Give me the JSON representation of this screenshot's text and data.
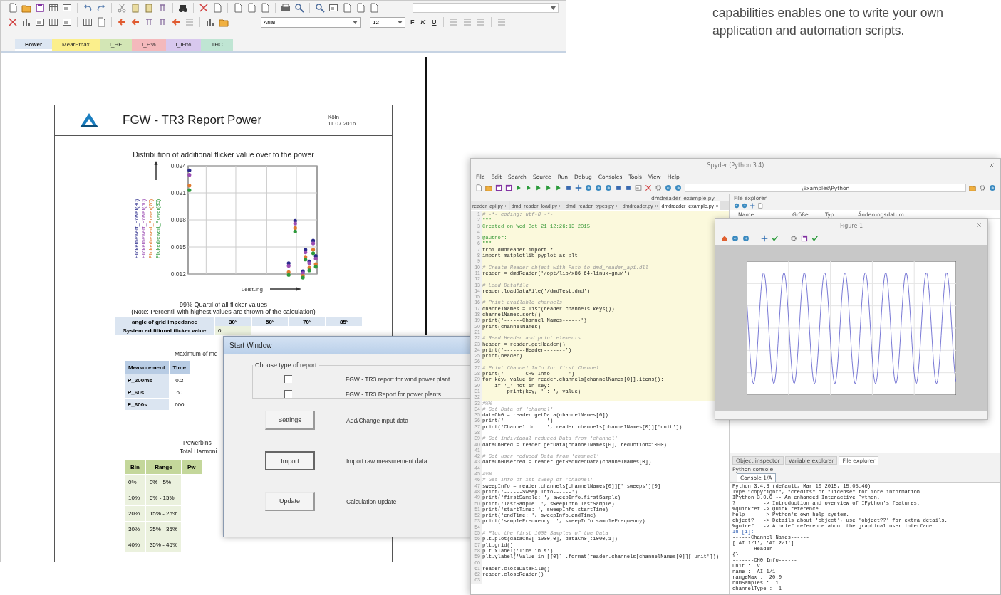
{
  "intro_text": "capabilities enables one to write your own application and automation scripts.",
  "report_window": {
    "font_name": "Arial",
    "font_size": "12",
    "format_buttons": [
      "F",
      "K",
      "U"
    ],
    "sheet_tabs": [
      {
        "label": "Power",
        "selected": true,
        "color": "#dce6f2"
      },
      {
        "label": "MearPmax",
        "selected": false,
        "color": "#fbef8c"
      },
      {
        "label": "I_HF",
        "selected": false,
        "color": "#d3e6b5"
      },
      {
        "label": "I_H%",
        "selected": false,
        "color": "#f4b9bc"
      },
      {
        "label": "I_IH%",
        "selected": false,
        "color": "#d8c8ee"
      },
      {
        "label": "THC",
        "selected": false,
        "color": "#bfe5d3"
      }
    ],
    "report": {
      "title": "FGW - TR3  Report Power",
      "place": "Köln",
      "date": "11.07.2016",
      "flicker_chart": {
        "title": "Distribution of additional flicker value over to the power",
        "xlabel": "Leistung",
        "y_tick_labels": [
          "0.024",
          "0.021",
          "0.018",
          "0.015",
          "0.012"
        ],
        "series": [
          {
            "name": "Flickerbewert_Power(30)",
            "color": "#2b2b8c"
          },
          {
            "name": "Flickerbewert_Power(50)",
            "color": "#9b4db3"
          },
          {
            "name": "Flickerbewert_Power(70)",
            "color": "#e07b30"
          },
          {
            "name": "Flickerbewert_Power(85)",
            "color": "#2f9a3c"
          }
        ]
      },
      "quantile_title": "99% Quartil of all flicker values",
      "quantile_note": "(Note: Percentil with highest values are thrown of the calculation)",
      "angle_table": {
        "columns": [
          "angle of grid impedance",
          "30°",
          "50°",
          "70°",
          "85°"
        ],
        "rows": [
          [
            "System additional flicker value",
            "0."
          ]
        ]
      },
      "maximum_title": "Maximum of me",
      "maximum_table": {
        "columns": [
          "Measurement",
          "Time"
        ],
        "rows": [
          [
            "P_200ms",
            "0.2"
          ],
          [
            "P_60s",
            "60"
          ],
          [
            "P_600s",
            "600"
          ]
        ]
      },
      "powerbins_title": "Powerbins",
      "powerbins_subtitle": "Total Harmoni",
      "powerbins_table": {
        "columns": [
          "Bin",
          "Range",
          "Pw"
        ],
        "rows": [
          [
            "0%",
            "0% - 5%"
          ],
          [
            "10%",
            "5% - 15%"
          ],
          [
            "20%",
            "15% - 25%"
          ],
          [
            "30%",
            "25% - 35%"
          ],
          [
            "40%",
            "35% - 45%"
          ]
        ]
      }
    }
  },
  "start_window": {
    "title": "Start Window",
    "group_title": "Choose type of report",
    "report_types": [
      {
        "label": "FGW - TR3 report for wind power plant",
        "checked": false
      },
      {
        "label": "FGW - TR3 Report for power plants",
        "checked": false
      }
    ],
    "actions": [
      {
        "button": "Settings",
        "description": "Add/Change input data",
        "default": false
      },
      {
        "button": "Import",
        "description": "Import raw measurement data",
        "default": true
      },
      {
        "button": "Update",
        "description": "Calculation update",
        "default": false
      }
    ]
  },
  "spyder": {
    "title": "Spyder (Python 3.4)",
    "menu": [
      "File",
      "Edit",
      "Search",
      "Source",
      "Run",
      "Debug",
      "Consoles",
      "Tools",
      "View",
      "Help"
    ],
    "path": "\\Examples\\Python",
    "current_file": "dmdreader_example.py",
    "explorer_title": "File explorer",
    "editor_tabs": [
      {
        "label": "reader_api.py",
        "selected": false
      },
      {
        "label": "dmd_reader_load.py",
        "selected": false
      },
      {
        "label": "dmd_reader_types.py",
        "selected": false
      },
      {
        "label": "dmdreader.py",
        "selected": false
      },
      {
        "label": "dmdreader_example.py",
        "selected": true
      }
    ],
    "code_lines": [
      {
        "number": "1",
        "code": "# -*- coding: utf-8 -*-",
        "kind": "comment",
        "highlighted": true
      },
      {
        "number": "2",
        "code": "\"\"\"",
        "kind": "docstring",
        "highlighted": true
      },
      {
        "number": "3",
        "code": "Created on Wed Oct 21 12:26:13 2015",
        "kind": "docstring",
        "highlighted": true
      },
      {
        "number": "4",
        "highlighted": true
      },
      {
        "number": "5",
        "code": "@author:",
        "kind": "docstring",
        "highlighted": true
      },
      {
        "number": "6",
        "code": "\"\"\"",
        "kind": "docstring",
        "highlighted": true
      },
      {
        "number": "7",
        "code": "from dmdreader import *",
        "kind": "code",
        "highlighted": true
      },
      {
        "number": "8",
        "code": "import matplotlib.pyplot as plt",
        "kind": "code",
        "highlighted": true
      },
      {
        "number": "9",
        "highlighted": true
      },
      {
        "number": "10",
        "code": "# Create Reader object with Path to dmd_reader_api.dll",
        "kind": "comment",
        "highlighted": true
      },
      {
        "number": "11",
        "code": "reader = dmdReader('/opt/lib/x86_64-linux-gnu/')",
        "kind": "code",
        "highlighted": true
      },
      {
        "number": "12",
        "highlighted": true
      },
      {
        "number": "13",
        "code": "# Load Datafile",
        "kind": "comment",
        "highlighted": true
      },
      {
        "number": "14",
        "code": "reader.loadDataFile('/dmdTest.dmd')",
        "kind": "code",
        "highlighted": true
      },
      {
        "number": "15",
        "highlighted": true
      },
      {
        "number": "16",
        "code": "# Print available channels",
        "kind": "comment",
        "highlighted": true
      },
      {
        "number": "17",
        "code": "channelNames = list(reader.channels.keys())",
        "kind": "code",
        "highlighted": true
      },
      {
        "number": "18",
        "code": "channelNames.sort()",
        "kind": "code",
        "highlighted": true
      },
      {
        "number": "19",
        "code": "print('------Channel Names------')",
        "kind": "code",
        "highlighted": true
      },
      {
        "number": "20",
        "code": "print(channelNames)",
        "kind": "code",
        "highlighted": true
      },
      {
        "number": "21",
        "highlighted": true
      },
      {
        "number": "22",
        "code": "# Read Header and print elements",
        "kind": "comment",
        "highlighted": true
      },
      {
        "number": "23",
        "code": "header = reader.getHeader()",
        "kind": "code",
        "highlighted": true
      },
      {
        "number": "24",
        "code": "print('-------Header-------')",
        "kind": "code",
        "highlighted": true
      },
      {
        "number": "25",
        "code": "print(header)",
        "kind": "code",
        "highlighted": true
      },
      {
        "number": "26",
        "highlighted": true
      },
      {
        "number": "27",
        "code": "# Print Channel Info for first Channel",
        "kind": "comment",
        "highlighted": true
      },
      {
        "number": "28",
        "code": "print('-------CH0 Info------')",
        "kind": "code",
        "highlighted": true
      },
      {
        "number": "29",
        "code": "for key, value in reader.channels[channelNames[0]].items():",
        "kind": "code",
        "highlighted": true
      },
      {
        "number": "30",
        "code": "    if '_' not in key:",
        "kind": "code",
        "highlighted": true
      },
      {
        "number": "31",
        "code": "        print(key, ' : ', value)",
        "kind": "code",
        "highlighted": true
      },
      {
        "number": "32",
        "highlighted": true
      },
      {
        "number": "33",
        "code": "#%%",
        "kind": "comment",
        "highlighted": false
      },
      {
        "number": "34",
        "code": "# Get Data of 'channel'",
        "kind": "comment",
        "highlighted": false
      },
      {
        "number": "35",
        "code": "dataCh0 = reader.getData(channelNames[0])",
        "kind": "code",
        "highlighted": false
      },
      {
        "number": "36",
        "code": "print('--------------')",
        "kind": "code",
        "highlighted": false
      },
      {
        "number": "37",
        "code": "print('Channel Unit: ', reader.channels[channelNames[0]]['unit'])",
        "kind": "code",
        "highlighted": false
      },
      {
        "number": "38",
        "highlighted": false
      },
      {
        "number": "39",
        "code": "# Get individual reduced Data from 'channel'",
        "kind": "comment",
        "highlighted": false
      },
      {
        "number": "40",
        "code": "dataCh0red = reader.getData(channelNames[0], reduction=1000)",
        "kind": "code",
        "highlighted": false
      },
      {
        "number": "41",
        "highlighted": false
      },
      {
        "number": "42",
        "code": "# Get user reduced Data from 'channel'",
        "kind": "comment",
        "highlighted": false
      },
      {
        "number": "43",
        "code": "dataCh0userred = reader.getReducedData(channelNames[0])",
        "kind": "code",
        "highlighted": false
      },
      {
        "number": "44",
        "highlighted": false
      },
      {
        "number": "45",
        "code": "#%%",
        "kind": "comment",
        "highlighted": false
      },
      {
        "number": "46",
        "code": "# Get Info of 1st sweep of 'channel'",
        "kind": "comment",
        "highlighted": false
      },
      {
        "number": "47",
        "code": "sweepInfo = reader.channels[channelNames[0]]['_sweeps'][0]",
        "kind": "code",
        "highlighted": false
      },
      {
        "number": "48",
        "code": "print('------Sweep Info------')",
        "kind": "code",
        "highlighted": false
      },
      {
        "number": "49",
        "code": "print('firstSample: ', sweepInfo.firstSample)",
        "kind": "code",
        "highlighted": false
      },
      {
        "number": "50",
        "code": "print('lastSample: ', sweepInfo.lastSample)",
        "kind": "code",
        "highlighted": false
      },
      {
        "number": "51",
        "code": "print('startTime: ', sweepInfo.startTime)",
        "kind": "code",
        "highlighted": false
      },
      {
        "number": "52",
        "code": "print('endTime: ', sweepInfo.endTime)",
        "kind": "code",
        "highlighted": false
      },
      {
        "number": "53",
        "code": "print('sampleFrequency: ', sweepInfo.sampleFrequency)",
        "kind": "code",
        "highlighted": false
      },
      {
        "number": "54",
        "highlighted": false
      },
      {
        "number": "55",
        "code": "# Plot the first 1000 Samples of the Data",
        "kind": "comment",
        "highlighted": false
      },
      {
        "number": "56",
        "code": "plt.plot(dataCh0[:1000,0], dataCh0[:1000,1])",
        "kind": "code",
        "highlighted": false
      },
      {
        "number": "57",
        "code": "plt.grid()",
        "kind": "code",
        "highlighted": false
      },
      {
        "number": "58",
        "code": "plt.xlabel('Time in s')",
        "kind": "code",
        "highlighted": false
      },
      {
        "number": "59",
        "code": "plt.ylabel('Value in [{0}]'.format(reader.channels[channelNames[0]]['unit']))",
        "kind": "code",
        "highlighted": false
      },
      {
        "number": "60",
        "highlighted": false
      },
      {
        "number": "61",
        "code": "reader.closeDataFile()",
        "kind": "code",
        "highlighted": false
      },
      {
        "number": "62",
        "code": "reader.closeReader()",
        "kind": "code",
        "highlighted": false
      },
      {
        "number": "63",
        "highlighted": false
      }
    ],
    "explorer_columns": [
      "Name",
      "Größe",
      "Typ",
      "Änderungsdatum"
    ],
    "pane_tabs": [
      {
        "label": "Object inspector",
        "selected": false
      },
      {
        "label": "Variable explorer",
        "selected": false
      },
      {
        "label": "File explorer",
        "selected": true
      }
    ],
    "console_title": "Python console",
    "console_tab": "Console 1/A",
    "console_lines": [
      {
        "text": "Python 3.4.3 (default, Mar 10 2015, 15:05:46)",
        "kind": "output"
      },
      {
        "text": "Type \"copyright\", \"credits\" or \"license\" for more information.",
        "kind": "output"
      },
      {
        "text": "IPython 3.0.0 -- An enhanced Interactive Python.",
        "kind": "output"
      },
      {
        "text": "?         -> Introduction and overview of IPython's features.",
        "kind": "output"
      },
      {
        "text": "%quickref -> Quick reference.",
        "kind": "output"
      },
      {
        "text": "help      -> Python's own help system.",
        "kind": "output"
      },
      {
        "text": "object?   -> Details about 'object', use 'object??' for extra details.",
        "kind": "output"
      },
      {
        "text": "%guiref   -> A brief reference about the graphical user interface.",
        "kind": "output"
      },
      {
        "text": "In [1]:",
        "kind": "prompt"
      },
      {
        "text": "------Channel Names------",
        "kind": "output"
      },
      {
        "text": "['AI 1/1', 'AI 2/1']",
        "kind": "output"
      },
      {
        "text": "-------Header-------",
        "kind": "output"
      },
      {
        "text": "{}",
        "kind": "output"
      },
      {
        "text": "-------CH0 Info------",
        "kind": "output"
      },
      {
        "text": "unit :  V",
        "kind": "output"
      },
      {
        "text": "name :  AI 1/1",
        "kind": "output"
      },
      {
        "text": "rangeMax :  20.0",
        "kind": "output"
      },
      {
        "text": "numSamples :  1",
        "kind": "output"
      },
      {
        "text": "channelType :  1",
        "kind": "output"
      }
    ]
  },
  "figure_window": {
    "title": "Figure 1"
  }
}
